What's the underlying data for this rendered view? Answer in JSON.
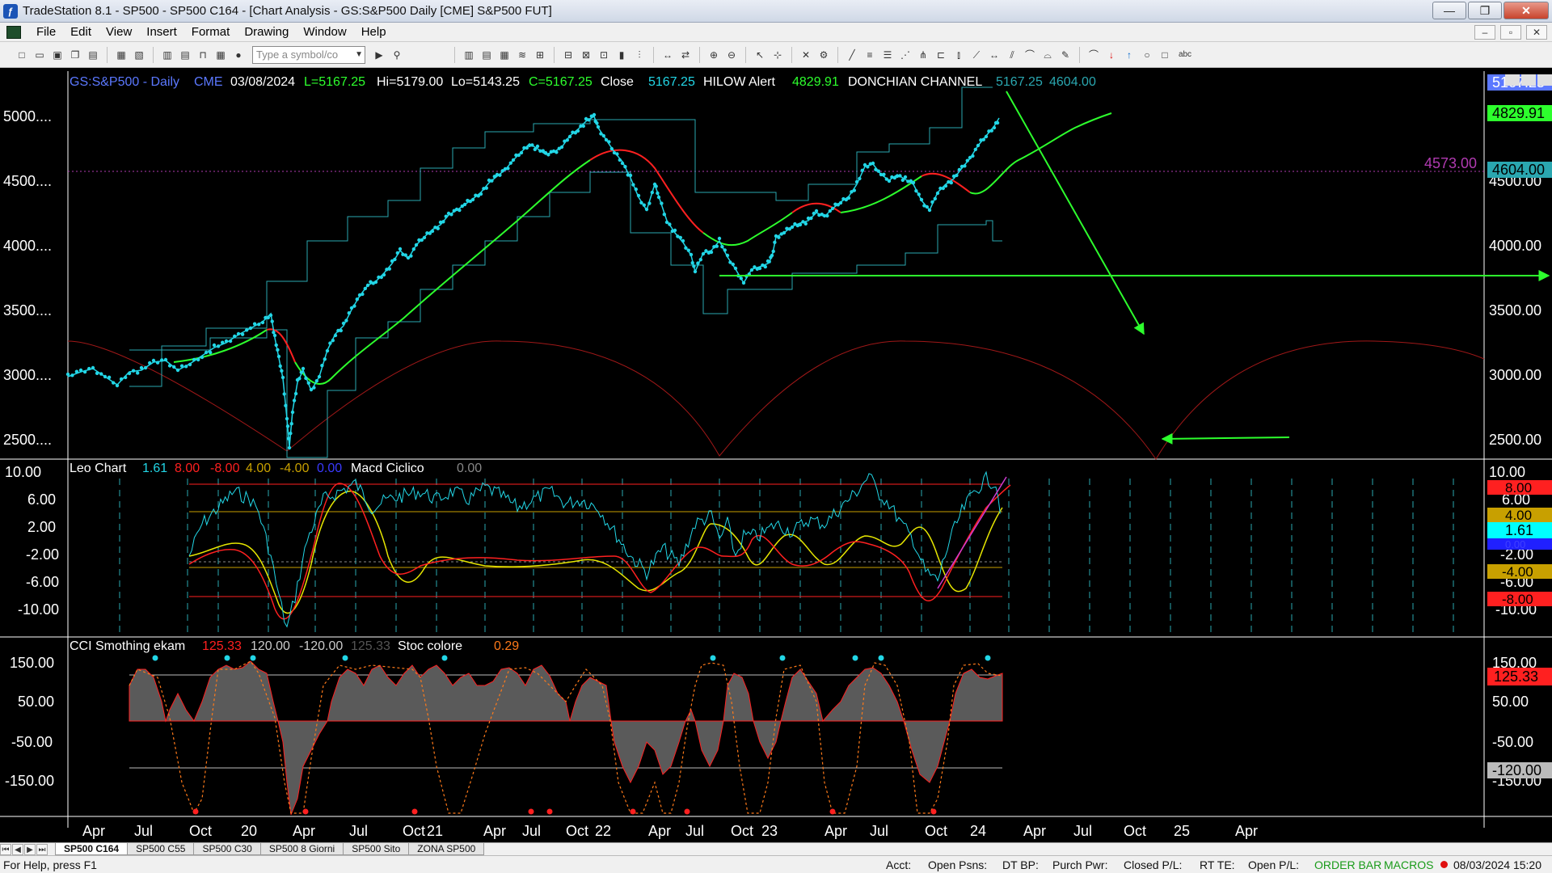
{
  "window": {
    "title": "TradeStation 8.1 - SP500 - SP500 C164 - [Chart Analysis - GS:S&P500  Daily  [CME] S&P500 FUT]",
    "buttons": [
      "—",
      "❐",
      "✕"
    ]
  },
  "menu": {
    "items": [
      "File",
      "Edit",
      "View",
      "Insert",
      "Format",
      "Drawing",
      "Window",
      "Help"
    ],
    "mdi_buttons": [
      "–",
      "▫",
      "✕"
    ]
  },
  "toolbar": {
    "symbol_placeholder": "Type a symbol/co"
  },
  "price_header": {
    "symbol": "GS:S&P500 - Daily",
    "exchange": "CME",
    "date": "03/08/2024",
    "last": "L=5167.25",
    "high": "Hi=5179.00",
    "low": "Lo=5143.25",
    "close_val": "C=5167.25",
    "close_label": "Close",
    "close_num": "5167.25",
    "hilow_label": "HILOW Alert",
    "hilow_val": "4829.91",
    "donchian_label": "DONCHIAN CHANNEL",
    "donchian_up": "5167.25",
    "donchian_low": "4604.00"
  },
  "price_axis": {
    "ticks_left": [
      "5000....",
      "4500....",
      "4000....",
      "3500....",
      "3000....",
      "2500...."
    ],
    "ticks_right": [
      "5000.00",
      "4500.00",
      "4000.00",
      "3500.00",
      "3000.00",
      "2500.00"
    ],
    "tags": {
      "last": "5167.25",
      "hilow": "4829.91",
      "donchian": "4604.00",
      "level": "4573.00"
    }
  },
  "leo_header": {
    "name": "Leo Chart",
    "v1": "1.61",
    "v2": "8.00",
    "v3": "-8.00",
    "v4": "4.00",
    "v5": "-4.00",
    "v6": "0.00",
    "macd_label": "Macd Ciclico",
    "macd_val": "0.00"
  },
  "leo_axis": {
    "ticks_left": [
      "10.00",
      "6.00",
      "2.00",
      "-2.00",
      "-6.00",
      "-10.00"
    ],
    "ticks_right": [
      "10.00",
      "6.00",
      "-2.00",
      "-6.00",
      "-10.00"
    ],
    "tags": {
      "t8": "8.00",
      "t4": "4.00",
      "t161": "1.61",
      "t0": "0.00",
      "tm4": "-4.00",
      "tm8": "-8.00"
    }
  },
  "cci_header": {
    "name": "CCI Smothing ekam",
    "v1": "125.33",
    "v2": "120.00",
    "v3": "-120.00",
    "v4": "125.33",
    "stoc_label": "Stoc colore",
    "stoc_val": "0.29"
  },
  "cci_axis": {
    "ticks_left": [
      "150.00",
      "50.00",
      "-50.00",
      "-150.00"
    ],
    "ticks_right": [
      "150.00",
      "50.00",
      "-50.00",
      "-150.00"
    ],
    "tags": {
      "cci": "125.33",
      "lower": "-120.00"
    }
  },
  "time_axis": {
    "labels": [
      "Apr",
      "Jul",
      "Oct",
      "20",
      "Apr",
      "Jul",
      "Oct",
      "21",
      "Apr",
      "Jul",
      "Oct",
      "22",
      "Apr",
      "Jul",
      "Oct",
      "23",
      "Apr",
      "Jul",
      "Oct",
      "24",
      "Apr",
      "Jul",
      "Oct",
      "25",
      "Apr"
    ]
  },
  "tabs": [
    "SP500 C164",
    "SP500 C55",
    "SP500 C30",
    "SP500 8 Giorni",
    "SP500 Sito",
    "ZONA SP500"
  ],
  "tab_nav": [
    "⏮",
    "◀",
    "▶",
    "⏭"
  ],
  "status": {
    "help": "For Help, press F1",
    "acct": "Acct:",
    "open_psns": "Open Psns:",
    "dt_bp": "DT BP:",
    "purch_pwr": "Purch Pwr:",
    "closed_pl": "Closed P/L:",
    "rt_te": "RT TE:",
    "open_pl": "Open P/L:",
    "order_bar": "ORDER BAR",
    "macros": "MACROS",
    "datetime": "08/03/2024 15:20"
  },
  "colors": {
    "price_marker": "#22d6e6",
    "hilow_line": "#2dff2d",
    "channel": "#2aa7b0",
    "cycle": "#a01818",
    "signal_arrow": "#2dff2d",
    "macd_yellow": "#e6e600",
    "macd_red": "#ff2020",
    "cci_fill": "#5a5a5a",
    "stoc": "#ff7a1a"
  }
}
